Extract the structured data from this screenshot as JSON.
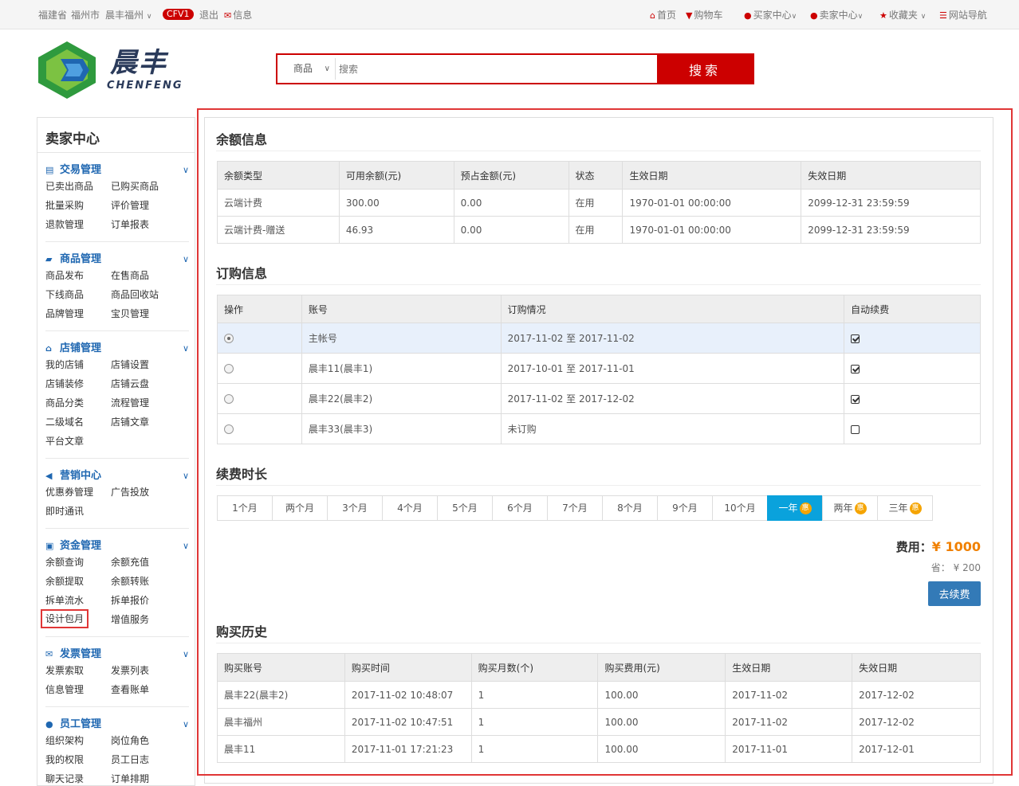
{
  "topbar": {
    "province": "福建省",
    "city": "福州市",
    "user": "晨丰福州",
    "badge": "CFV1",
    "logout": "退出",
    "message": "信息",
    "home": "首页",
    "cart": "购物车",
    "buyer_center": "买家中心",
    "seller_center": "卖家中心",
    "favorites": "收藏夹",
    "site_nav": "网站导航"
  },
  "logo": {
    "cn": "晨丰",
    "en": "CHENFENG"
  },
  "search": {
    "category": "商品",
    "placeholder": "搜索",
    "button": "搜索"
  },
  "sidebar": {
    "title": "卖家中心",
    "groups": [
      {
        "title": "交易管理",
        "items": [
          "已卖出商品",
          "已购买商品",
          "批量采购",
          "评价管理",
          "退款管理",
          "订单报表"
        ]
      },
      {
        "title": "商品管理",
        "items": [
          "商品发布",
          "在售商品",
          "下线商品",
          "商品回收站",
          "品牌管理",
          "宝贝管理"
        ]
      },
      {
        "title": "店铺管理",
        "items": [
          "我的店铺",
          "店铺设置",
          "店铺装修",
          "店铺云盘",
          "商品分类",
          "流程管理",
          "二级域名",
          "店铺文章",
          "平台文章"
        ]
      },
      {
        "title": "营销中心",
        "items": [
          "优惠券管理",
          "广告投放",
          "即时通讯"
        ]
      },
      {
        "title": "资金管理",
        "items": [
          "余额查询",
          "余额充值",
          "余额提取",
          "余额转账",
          "拆单流水",
          "拆单报价",
          "设计包月",
          "增值服务"
        ]
      },
      {
        "title": "发票管理",
        "items": [
          "发票索取",
          "发票列表",
          "信息管理",
          "查看账单"
        ]
      },
      {
        "title": "员工管理",
        "items": [
          "组织架构",
          "岗位角色",
          "我的权限",
          "员工日志",
          "聊天记录",
          "订单排期"
        ]
      }
    ]
  },
  "balance": {
    "title": "余额信息",
    "headers": [
      "余额类型",
      "可用余额(元)",
      "预占金额(元)",
      "状态",
      "生效日期",
      "失效日期"
    ],
    "rows": [
      [
        "云端计费",
        "300.00",
        "0.00",
        "在用",
        "1970-01-01 00:00:00",
        "2099-12-31 23:59:59"
      ],
      [
        "云端计费-赠送",
        "46.93",
        "0.00",
        "在用",
        "1970-01-01 00:00:00",
        "2099-12-31 23:59:59"
      ]
    ]
  },
  "subscription": {
    "title": "订购信息",
    "headers": [
      "操作",
      "账号",
      "订购情况",
      "自动续费"
    ],
    "rows": [
      {
        "account": "主帐号",
        "status": "2017-11-02 至 2017-11-02",
        "selected": true,
        "auto": true
      },
      {
        "account": "晨丰11(晨丰1)",
        "status": "2017-10-01 至 2017-11-01",
        "selected": false,
        "auto": true
      },
      {
        "account": "晨丰22(晨丰2)",
        "status": "2017-11-02 至 2017-12-02",
        "selected": false,
        "auto": true
      },
      {
        "account": "晨丰33(晨丰3)",
        "status": "未订购",
        "selected": false,
        "auto": false
      }
    ]
  },
  "renewal": {
    "title": "续费时长",
    "options": [
      "1个月",
      "两个月",
      "3个月",
      "4个月",
      "5个月",
      "6个月",
      "7个月",
      "8个月",
      "9个月",
      "10个月",
      "一年",
      "两年",
      "三年"
    ],
    "discount_badge": "惠",
    "selected": "一年",
    "fee_label": "费用：",
    "fee_amount": "¥ 1000",
    "save_label": "省：",
    "save_amount": "¥ 200",
    "button": "去续费"
  },
  "history": {
    "title": "购买历史",
    "headers": [
      "购买账号",
      "购买时间",
      "购买月数(个)",
      "购买费用(元)",
      "生效日期",
      "失效日期"
    ],
    "rows": [
      [
        "晨丰22(晨丰2)",
        "2017-11-02 10:48:07",
        "1",
        "100.00",
        "2017-11-02",
        "2017-12-02"
      ],
      [
        "晨丰福州",
        "2017-11-02 10:47:51",
        "1",
        "100.00",
        "2017-11-02",
        "2017-12-02"
      ],
      [
        "晨丰11",
        "2017-11-01 17:21:23",
        "1",
        "100.00",
        "2017-11-01",
        "2017-12-01"
      ]
    ]
  },
  "colors": {
    "brand": "#cc0000",
    "link": "#1f67b1",
    "accent": "#0aa2dc",
    "price": "#f08000",
    "button": "#337ab7",
    "highlight": "#e03636"
  }
}
